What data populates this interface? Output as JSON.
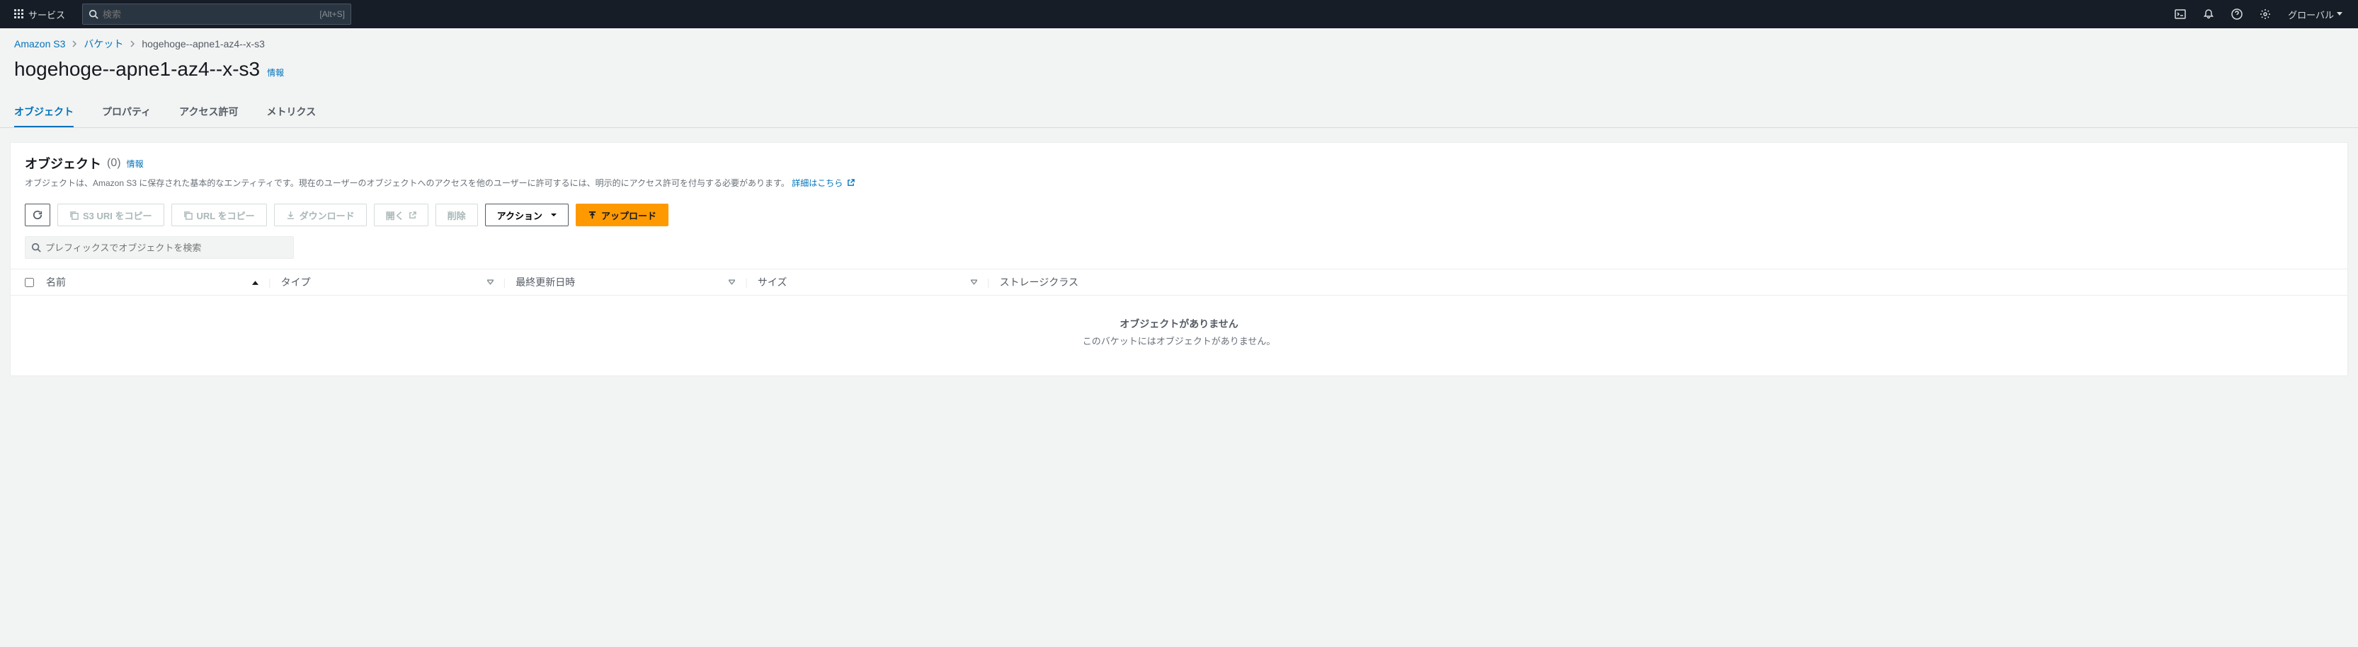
{
  "topnav": {
    "services_label": "サービス",
    "search_placeholder": "検索",
    "search_shortcut": "[Alt+S]",
    "region_label": "グローバル"
  },
  "breadcrumb": {
    "root": "Amazon S3",
    "buckets": "バケット",
    "current": "hogehoge--apne1-az4--x-s3"
  },
  "page": {
    "title": "hogehoge--apne1-az4--x-s3",
    "info_label": "情報"
  },
  "tabs": {
    "objects": "オブジェクト",
    "properties": "プロパティ",
    "permissions": "アクセス許可",
    "metrics": "メトリクス"
  },
  "panel": {
    "title": "オブジェクト",
    "count": "(0)",
    "info_label": "情報",
    "desc_prefix": "オブジェクトは、Amazon S3 に保存された基本的なエンティティです。現在のユーザーのオブジェクトへのアクセスを他のユーザーに許可するには、明示的にアクセス許可を付与する必要があります。",
    "learn_more": "詳細はこちら"
  },
  "buttons": {
    "copy_s3_uri": "S3 URI をコピー",
    "copy_url": "URL をコピー",
    "download": "ダウンロード",
    "open": "開く",
    "delete": "削除",
    "actions": "アクション",
    "upload": "アップロード"
  },
  "filter": {
    "placeholder": "プレフィックスでオブジェクトを検索"
  },
  "columns": {
    "name": "名前",
    "type": "タイプ",
    "modified": "最終更新日時",
    "size": "サイズ",
    "storage_class": "ストレージクラス"
  },
  "empty": {
    "title": "オブジェクトがありません",
    "subtitle": "このバケットにはオブジェクトがありません。"
  }
}
